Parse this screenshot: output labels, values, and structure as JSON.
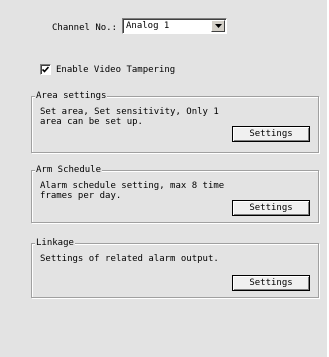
{
  "channel": {
    "label": "Channel No.:",
    "selected": "Analog 1"
  },
  "tampering": {
    "label": "Enable Video Tampering",
    "checked": true
  },
  "groups": [
    {
      "title": "Area settings",
      "description": "Set area, Set sensitivity, Only 1\narea can be set up.",
      "button": "Settings"
    },
    {
      "title": "Arm Schedule",
      "description": "Alarm schedule setting, max 8 time\nframes per day.",
      "button": "Settings"
    },
    {
      "title": "Linkage",
      "description": "Settings of related alarm output.",
      "button": "Settings"
    }
  ]
}
